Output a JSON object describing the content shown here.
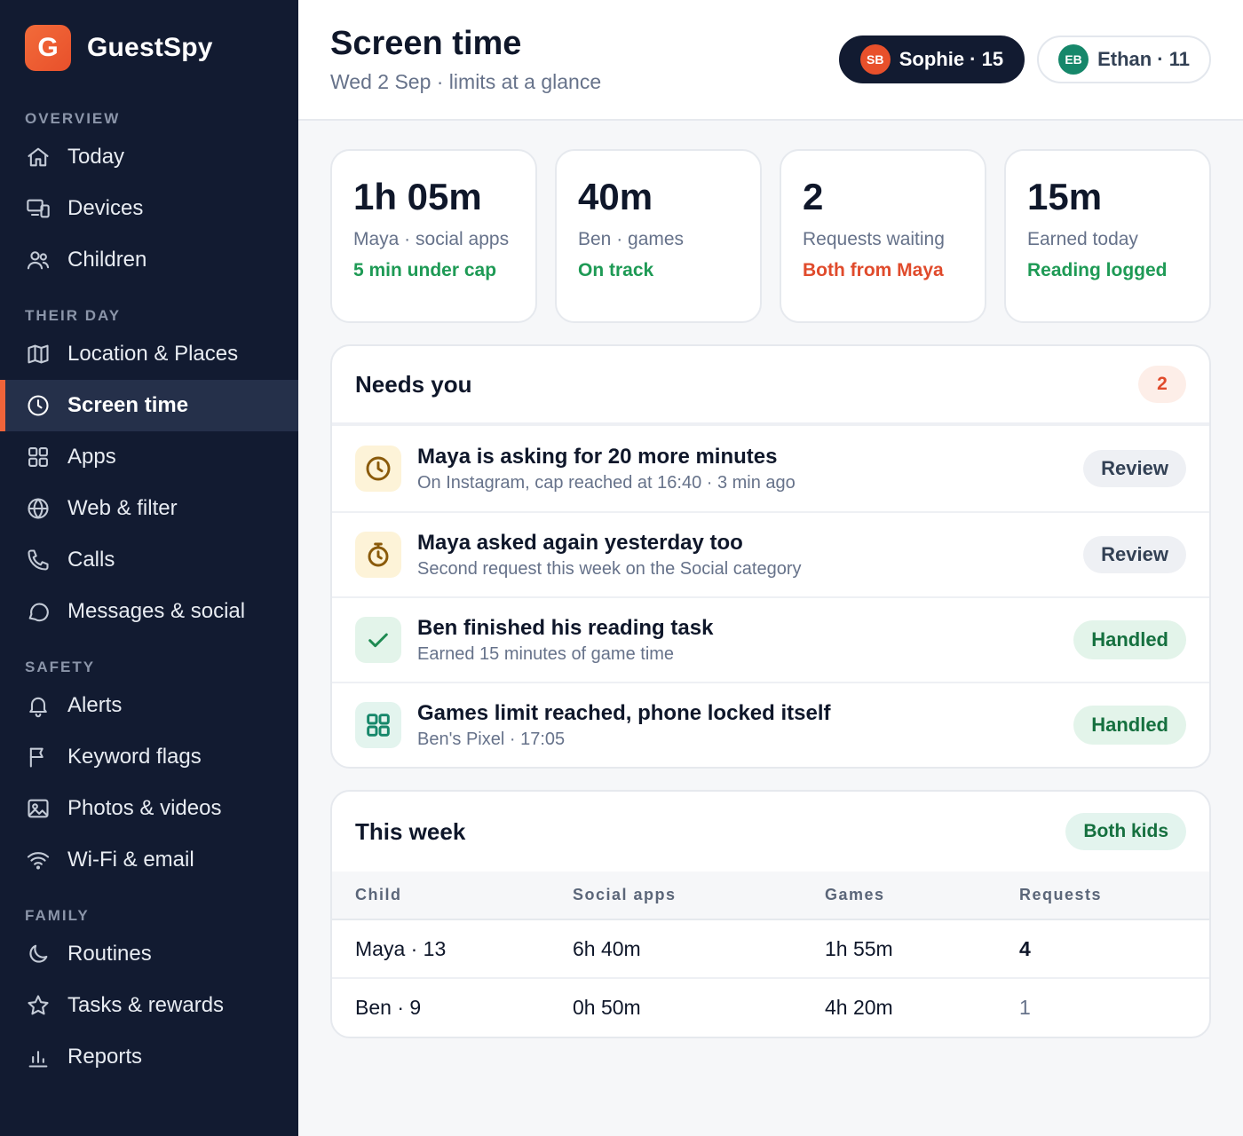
{
  "brand": {
    "logo_letter": "G",
    "name": "GuestSpy"
  },
  "sidebar": {
    "sections": [
      {
        "label": "OVERVIEW",
        "items": [
          {
            "label": "Today",
            "icon": "home-icon"
          },
          {
            "label": "Devices",
            "icon": "devices-icon"
          },
          {
            "label": "Children",
            "icon": "users-icon"
          }
        ]
      },
      {
        "label": "THEIR DAY",
        "items": [
          {
            "label": "Location & Places",
            "icon": "map-icon"
          },
          {
            "label": "Screen time",
            "icon": "clock-icon",
            "active": true
          },
          {
            "label": "Apps",
            "icon": "grid-icon"
          },
          {
            "label": "Web & filter",
            "icon": "globe-icon"
          },
          {
            "label": "Calls",
            "icon": "phone-icon"
          },
          {
            "label": "Messages & social",
            "icon": "chat-icon"
          }
        ]
      },
      {
        "label": "SAFETY",
        "items": [
          {
            "label": "Alerts",
            "icon": "bell-icon"
          },
          {
            "label": "Keyword flags",
            "icon": "flag-icon"
          },
          {
            "label": "Photos & videos",
            "icon": "image-icon"
          },
          {
            "label": "Wi-Fi & email",
            "icon": "wifi-icon"
          }
        ]
      },
      {
        "label": "FAMILY",
        "items": [
          {
            "label": "Routines",
            "icon": "moon-icon"
          },
          {
            "label": "Tasks & rewards",
            "icon": "star-icon"
          },
          {
            "label": "Reports",
            "icon": "bar-chart-icon"
          }
        ]
      }
    ]
  },
  "header": {
    "title": "Screen time",
    "subtitle": "Wed 2 Sep · limits at a glance",
    "kids": [
      {
        "initials": "SB",
        "label": "Sophie · 15",
        "active": true,
        "color": "#e8502b"
      },
      {
        "initials": "EB",
        "label": "Ethan · 11",
        "active": false,
        "color": "#16876a"
      }
    ]
  },
  "stats": [
    {
      "value": "1h 05m",
      "label": "Maya · social apps",
      "status": "5 min under cap",
      "tone": "green"
    },
    {
      "value": "40m",
      "label": "Ben · games",
      "status": "On track",
      "tone": "green"
    },
    {
      "value": "2",
      "label": "Requests waiting",
      "status": "Both from Maya",
      "tone": "red"
    },
    {
      "value": "15m",
      "label": "Earned today",
      "status": "Reading logged",
      "tone": "green"
    }
  ],
  "needs": {
    "title": "Needs you",
    "count": "2",
    "items": [
      {
        "icon": "clock-icon",
        "tone": "amber",
        "title": "Maya is asking for 20 more minutes",
        "sub": "On Instagram, cap reached at 16:40 · 3 min ago",
        "action": "Review",
        "kind": "review"
      },
      {
        "icon": "stopwatch-icon",
        "tone": "amber",
        "title": "Maya asked again yesterday too",
        "sub": "Second request this week on the Social category",
        "action": "Review",
        "kind": "review"
      },
      {
        "icon": "check-icon",
        "tone": "green",
        "title": "Ben finished his reading task",
        "sub": "Earned 15 minutes of game time",
        "action": "Handled",
        "kind": "handled"
      },
      {
        "icon": "grid-icon",
        "tone": "teal",
        "title": "Games limit reached, phone locked itself",
        "sub": "Ben's Pixel · 17:05",
        "action": "Handled",
        "kind": "handled"
      }
    ]
  },
  "week": {
    "title": "This week",
    "badge": "Both kids",
    "columns": [
      "Child",
      "Social apps",
      "Games",
      "Requests"
    ],
    "rows": [
      [
        "Maya · 13",
        "6h 40m",
        "1h 55m",
        "4"
      ],
      [
        "Ben · 9",
        "0h 50m",
        "4h 20m",
        "1"
      ]
    ]
  }
}
